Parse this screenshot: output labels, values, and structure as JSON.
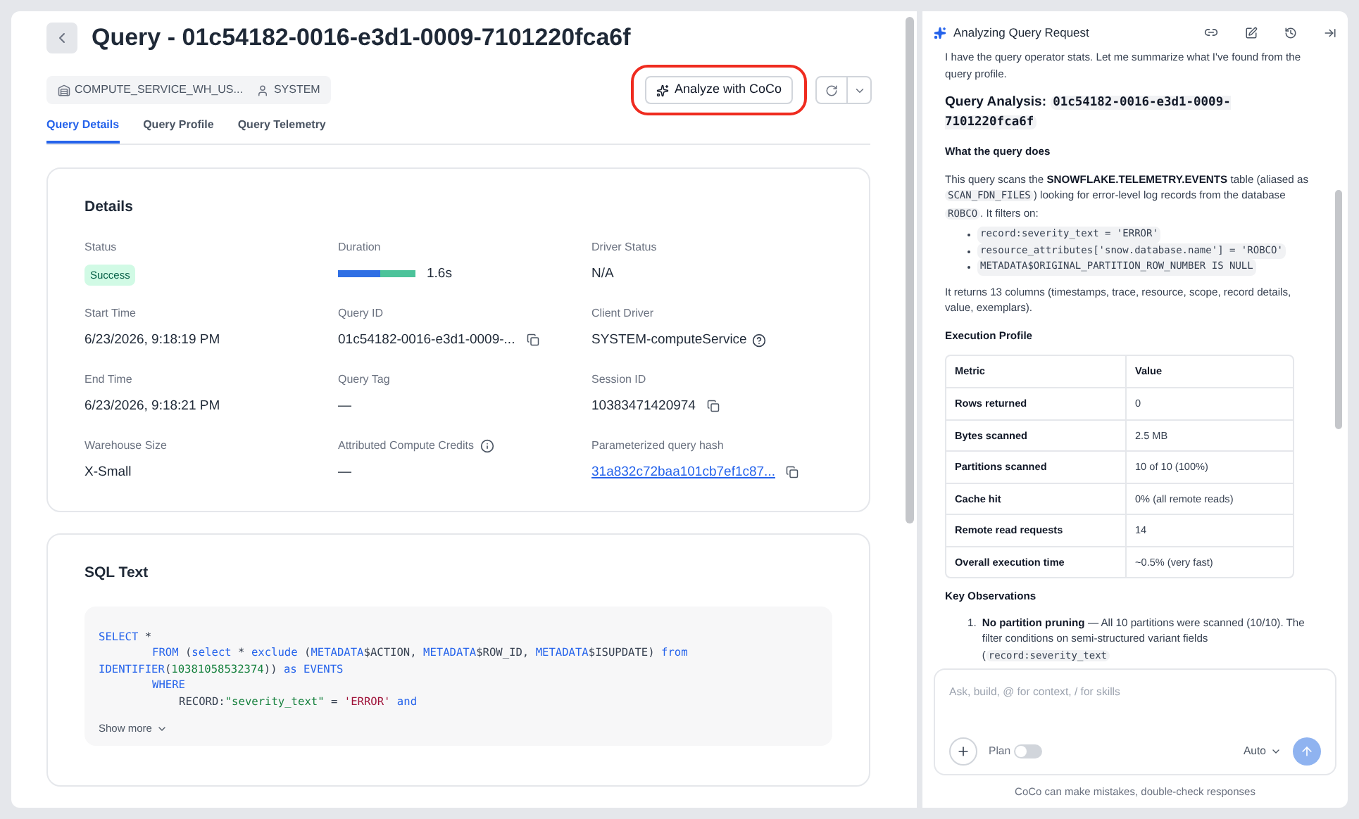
{
  "header": {
    "title": "Query - 01c54182-0016-e3d1-0009-7101220fca6f",
    "warehouse": "COMPUTE_SERVICE_WH_US...",
    "user": "SYSTEM",
    "analyze_button": "Analyze with CoCo"
  },
  "tabs": [
    {
      "label": "Query Details",
      "selected": true
    },
    {
      "label": "Query Profile",
      "selected": false
    },
    {
      "label": "Query Telemetry",
      "selected": false
    }
  ],
  "details": {
    "title": "Details",
    "fields": [
      {
        "label": "Status",
        "value": "Success",
        "kind": "badge",
        "copyable": false,
        "link": false,
        "label_info": false
      },
      {
        "label": "Duration",
        "value": "1.6s",
        "kind": "duration",
        "level": 0.55,
        "copyable": false,
        "link": false,
        "label_info": false
      },
      {
        "label": "Driver Status",
        "value": "N/A",
        "kind": "text",
        "copyable": false,
        "link": false,
        "label_info": false
      },
      {
        "label": "Start Time",
        "value": "6/23/2026, 9:18:19 PM",
        "kind": "text",
        "copyable": false,
        "link": false,
        "label_info": false
      },
      {
        "label": "Query ID",
        "value": "01c54182-0016-e3d1-0009-...",
        "kind": "text",
        "copyable": true,
        "link": false,
        "label_info": false
      },
      {
        "label": "Client Driver",
        "value": "SYSTEM-computeService",
        "kind": "help",
        "copyable": false,
        "link": false,
        "label_info": false
      },
      {
        "label": "End Time",
        "value": "6/23/2026, 9:18:21 PM",
        "kind": "text",
        "copyable": false,
        "link": false,
        "label_info": false
      },
      {
        "label": "Query Tag",
        "value": "—",
        "kind": "text",
        "copyable": false,
        "link": false,
        "label_info": false
      },
      {
        "label": "Session ID",
        "value": "10383471420974",
        "kind": "text",
        "copyable": true,
        "link": false,
        "label_info": false
      },
      {
        "label": "Warehouse Size",
        "value": "X-Small",
        "kind": "text",
        "copyable": false,
        "link": false,
        "label_info": false
      },
      {
        "label": "Attributed Compute Credits",
        "value": "—",
        "kind": "text",
        "copyable": false,
        "link": false,
        "label_info": true
      },
      {
        "label": "Parameterized query hash",
        "value": "31a832c72baa101cb7ef1c87...",
        "kind": "text",
        "copyable": true,
        "link": true,
        "label_info": false
      }
    ]
  },
  "sql": {
    "title": "SQL Text",
    "show_more": "Show more",
    "lines": [
      {
        "kind": "top",
        "tokens": [
          {
            "kind": "keyword",
            "text": "SELECT"
          },
          {
            "kind": "plain",
            "text": " *"
          }
        ]
      },
      {
        "kind": "clause",
        "tokens": [
          {
            "kind": "keyword",
            "text": "FROM"
          },
          {
            "kind": "plain",
            "text": " ("
          },
          {
            "kind": "keyword",
            "text": "select"
          },
          {
            "kind": "plain",
            "text": " * "
          },
          {
            "kind": "keyword",
            "text": "exclude"
          },
          {
            "kind": "plain",
            "text": " ("
          },
          {
            "kind": "keyword",
            "text": "METADATA"
          },
          {
            "kind": "plain",
            "text": "$ACTION, "
          },
          {
            "kind": "keyword",
            "text": "METADATA"
          },
          {
            "kind": "plain",
            "text": "$ROW_ID, "
          },
          {
            "kind": "keyword",
            "text": "METADATA"
          },
          {
            "kind": "plain",
            "text": "$ISUPDATE) "
          },
          {
            "kind": "keyword",
            "text": "from"
          }
        ]
      },
      {
        "kind": "top",
        "tokens": [
          {
            "kind": "keyword",
            "text": "IDENTIFIER"
          },
          {
            "kind": "plain",
            "text": "("
          },
          {
            "kind": "number",
            "text": "10381058532374"
          },
          {
            "kind": "plain",
            "text": ")) "
          },
          {
            "kind": "keyword",
            "text": "as EVENTS"
          }
        ]
      },
      {
        "kind": "clause",
        "tokens": [
          {
            "kind": "keyword",
            "text": "WHERE"
          }
        ]
      },
      {
        "kind": "condition",
        "tokens": [
          {
            "kind": "plain",
            "text": "RECORD:"
          },
          {
            "kind": "number",
            "text": "\"severity_text\""
          },
          {
            "kind": "plain",
            "text": " = "
          },
          {
            "kind": "string",
            "text": "'ERROR'"
          },
          {
            "kind": "keyword",
            "text": " and"
          }
        ]
      }
    ]
  },
  "chat": {
    "title": "Analyzing Query Request",
    "intro": "I have the query operator stats. Let me summarize what I've found from the query profile.",
    "heading": [
      {
        "kind": "text",
        "text": "Query Analysis: "
      },
      {
        "kind": "code",
        "text": "01c54182-0016-e3d1-0009-7101220fca6f"
      }
    ],
    "section_1": "What the query does",
    "paragraph_1": [
      {
        "kind": "text",
        "text": "This query scans the "
      },
      {
        "kind": "bold",
        "text": "SNOWFLAKE.TELEMETRY.EVENTS"
      },
      {
        "kind": "text",
        "text": " table (aliased as "
      },
      {
        "kind": "code",
        "text": "SCAN_FDN_FILES"
      },
      {
        "kind": "text",
        "text": ") looking for error-level log records from the database "
      },
      {
        "kind": "code",
        "text": "ROBCO"
      },
      {
        "kind": "text",
        "text": ". It filters on:"
      }
    ],
    "filters": [
      "record:severity_text = 'ERROR'",
      "resource_attributes['snow.database.name'] = 'ROBCO'",
      "METADATA$ORIGINAL_PARTITION_ROW_NUMBER IS NULL"
    ],
    "paragraph_2": "It returns 13 columns (timestamps, trace, resource, scope, record details, value, exemplars).",
    "section_2": "Execution Profile",
    "table": {
      "columns": [
        "Metric",
        "Value"
      ],
      "rows": [
        [
          "Rows returned",
          "0"
        ],
        [
          "Bytes scanned",
          "2.5 MB"
        ],
        [
          "Partitions scanned",
          "10 of 10 (100%)"
        ],
        [
          "Cache hit",
          "0% (all remote reads)"
        ],
        [
          "Remote read requests",
          "14"
        ],
        [
          "Overall execution time",
          "~0.5% (very fast)"
        ]
      ]
    },
    "section_3": "Key Observations",
    "observations": [
      {
        "number": "1.",
        "parts": [
          {
            "kind": "bold",
            "text": "No partition pruning"
          },
          {
            "kind": "text",
            "text": " — All 10 partitions were scanned (10/10). The filter conditions on semi-structured variant fields ("
          },
          {
            "kind": "code",
            "text": "record:severity_text"
          }
        ]
      }
    ],
    "input_placeholder": "Ask, build, @ for context, / for skills",
    "plan": {
      "label": "Plan",
      "on": false
    },
    "mode": "Auto",
    "disclaimer": "CoCo can make mistakes, double-check responses"
  }
}
